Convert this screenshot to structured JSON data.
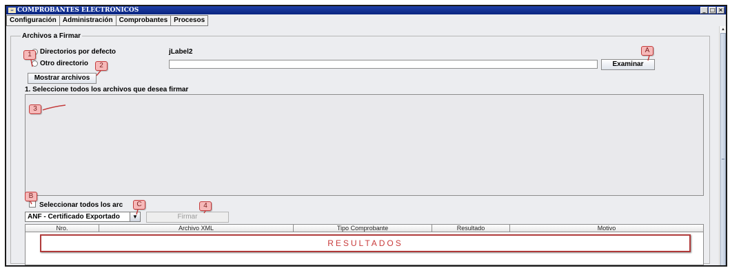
{
  "window": {
    "title": "COMPROBANTES ELECTRÓNICOS",
    "app_icon": "java-cup-icon",
    "controls": {
      "minimize": "_",
      "maximize": "□",
      "close": "×"
    }
  },
  "menubar": {
    "items": [
      {
        "label": "Configuración"
      },
      {
        "label": "Administración"
      },
      {
        "label": "Comprobantes"
      },
      {
        "label": "Procesos"
      }
    ]
  },
  "form": {
    "section_title": "Archivos a Firmar",
    "radio_default_label": "Directorios por defecto",
    "default_path_label": "jLabel2",
    "radio_other_label": "Otro directorio",
    "directory_input_value": "",
    "browse_button": "Examinar",
    "show_files_button": "Mostrar archivos",
    "instruction": "1. Seleccione todos los archivos que desea firmar",
    "select_all_label": "Seleccionar todos los arc",
    "certificate_selected": "ANF - Certificado Exportado",
    "sign_button": "Firmar"
  },
  "table": {
    "columns": [
      "Nro.",
      "Archivo XML",
      "Tipo Comprobante",
      "Resultado",
      "Motivo"
    ],
    "rows": []
  },
  "annotations": {
    "results_label": "RESULTADOS",
    "badges": [
      "1",
      "2",
      "3",
      "4",
      "A",
      "B",
      "C"
    ],
    "color": "#c43b3b"
  }
}
